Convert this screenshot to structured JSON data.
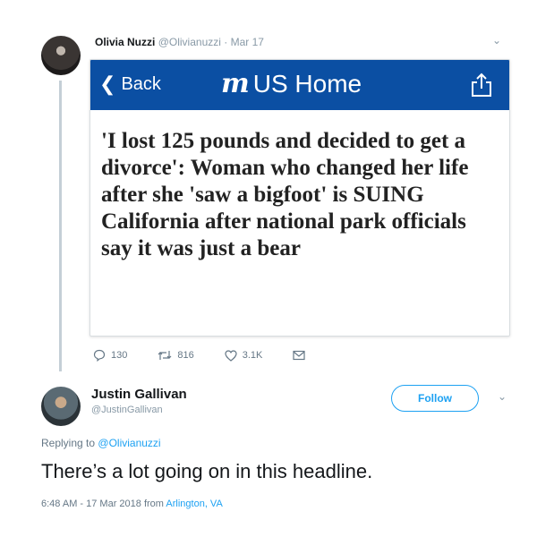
{
  "parent_tweet": {
    "display_name": "Olivia Nuzzi",
    "handle": "@Olivianuzzi",
    "separator": "·",
    "date": "Mar 17",
    "embedded": {
      "back_label": "Back",
      "logo_text": "m",
      "home_label": "US Home",
      "headline": "'I lost 125 pounds and decided to get a divorce': Woman who changed her life after she 'saw a bigfoot' is SUING California after national park officials say it was just a bear"
    },
    "actions": {
      "replies": "130",
      "retweets": "816",
      "likes": "3.1K"
    }
  },
  "reply_tweet": {
    "display_name": "Justin Gallivan",
    "handle": "@JustinGallivan",
    "follow_label": "Follow",
    "replying_to_prefix": "Replying to",
    "replying_to_handle": "@Olivianuzzi",
    "text": "There’s a lot going on in this headline.",
    "timestamp": "6:48 AM - 17 Mar 2018 from",
    "location": "Arlington, VA"
  },
  "colors": {
    "link_blue": "#1da1f2",
    "navbar_blue": "#0b4fa3",
    "muted_gray": "#657786"
  }
}
